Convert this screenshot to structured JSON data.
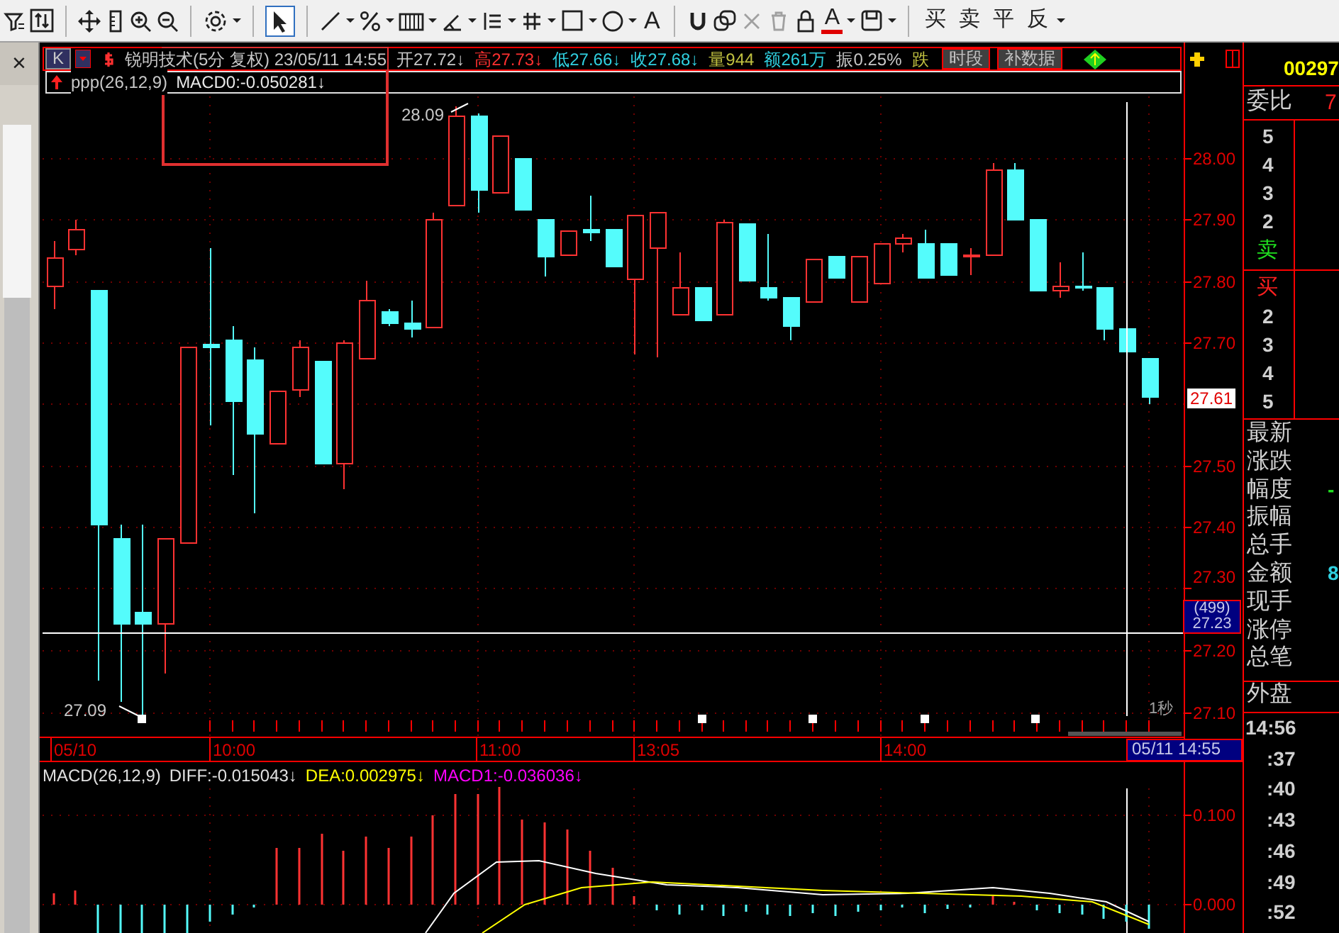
{
  "toolbar": {
    "text_tool": "A",
    "font_color_tool": "A",
    "trade_buttons": [
      "买",
      "卖",
      "平",
      "反"
    ]
  },
  "side_strip": {
    "close": "×"
  },
  "header": {
    "period_button": "K",
    "title": "锐明技术(5分 复权) 23/05/11 14:55",
    "quotes": [
      {
        "text": "开27.72↓",
        "kind": "open"
      },
      {
        "text": "高27.73↓",
        "kind": "high"
      },
      {
        "text": "低27.66↓",
        "kind": "low"
      },
      {
        "text": "收27.68↓",
        "kind": "close"
      },
      {
        "text": "量944",
        "kind": "volume"
      },
      {
        "text": "额261万",
        "kind": "amount"
      },
      {
        "text": "振0.25%",
        "kind": "amplitude"
      },
      {
        "text": "跌",
        "kind": "fall"
      }
    ],
    "buttons": [
      "时段",
      "补数据"
    ]
  },
  "indicator_line": {
    "name": "ppp(26,12,9)",
    "value": "MACD0:-0.050281↓"
  },
  "price_axis": {
    "ticks": [
      "28.00",
      "27.90",
      "27.80",
      "27.70",
      "27.50",
      "27.40",
      "27.30",
      "27.20",
      "27.10"
    ],
    "current": "27.61",
    "cursor_volume": "(499)",
    "cursor_price": "27.23"
  },
  "chart_labels": {
    "high": "28.09",
    "low": "27.09",
    "interval": "1秒"
  },
  "time_axis": {
    "labels": [
      "05/10",
      "10:00",
      "11:00",
      "13:05",
      "14:00"
    ],
    "cursor": "05/11 14:55"
  },
  "macd": {
    "title": "MACD(26,12,9)",
    "diff": "DIFF:-0.015043↓",
    "dea": "DEA:0.002975↓",
    "macd1": "MACD1:-0.036036↓",
    "ticks": [
      "0.100",
      "0.000"
    ]
  },
  "right_panel": {
    "code": "00297",
    "ratio_label": "委比",
    "ratio_value": "7",
    "sell_levels": [
      "5",
      "4",
      "3",
      "2"
    ],
    "sell_label": "卖",
    "buy_label": "买",
    "buy_levels": [
      "2",
      "3",
      "4",
      "5"
    ],
    "stats": [
      {
        "label": "最新"
      },
      {
        "label": "涨跌"
      },
      {
        "label": "幅度",
        "value": "-"
      },
      {
        "label": "振幅"
      },
      {
        "label": "总手"
      },
      {
        "label": "金额",
        "value": "8"
      },
      {
        "label": "现手"
      },
      {
        "label": "涨停"
      },
      {
        "label": "总笔"
      }
    ],
    "outer_label": "外盘",
    "ticks": [
      "14:56",
      ":37",
      ":40",
      ":43",
      ":46",
      ":49",
      ":52"
    ]
  }
}
